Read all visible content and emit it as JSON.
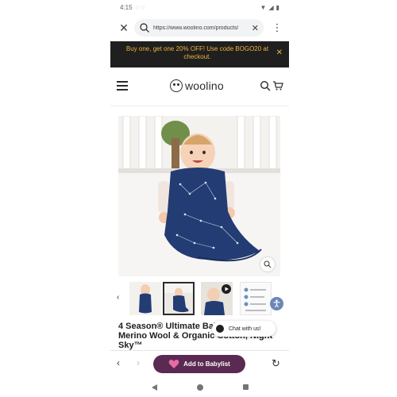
{
  "status": {
    "time": "4:15"
  },
  "browser": {
    "url": "https://www.woolino.com/products/",
    "close_label": "✕",
    "clear_label": "✕",
    "menu_label": "⋮"
  },
  "promo": {
    "text": "Buy one, get one 20% OFF! Use code BOGO20 at checkout.",
    "close_label": "✕"
  },
  "header": {
    "logo_text": "woolino"
  },
  "product": {
    "title": "4 Season® Ultimate Baby Sleep Bag, Merino Wool & Organic Cotton, Night Sky™"
  },
  "chat": {
    "label": "Chat with us!"
  },
  "toolbar": {
    "back_label": "‹",
    "forward_label": "›",
    "babylist_label": "Add to Babylist",
    "reload_label": "↻"
  },
  "colors": {
    "promo_bg": "#1f1f1f",
    "promo_text": "#f3b23c",
    "babylist_bg": "#5a2a52",
    "heart": "#e86aa6",
    "sleep_bag": "#233c73"
  }
}
